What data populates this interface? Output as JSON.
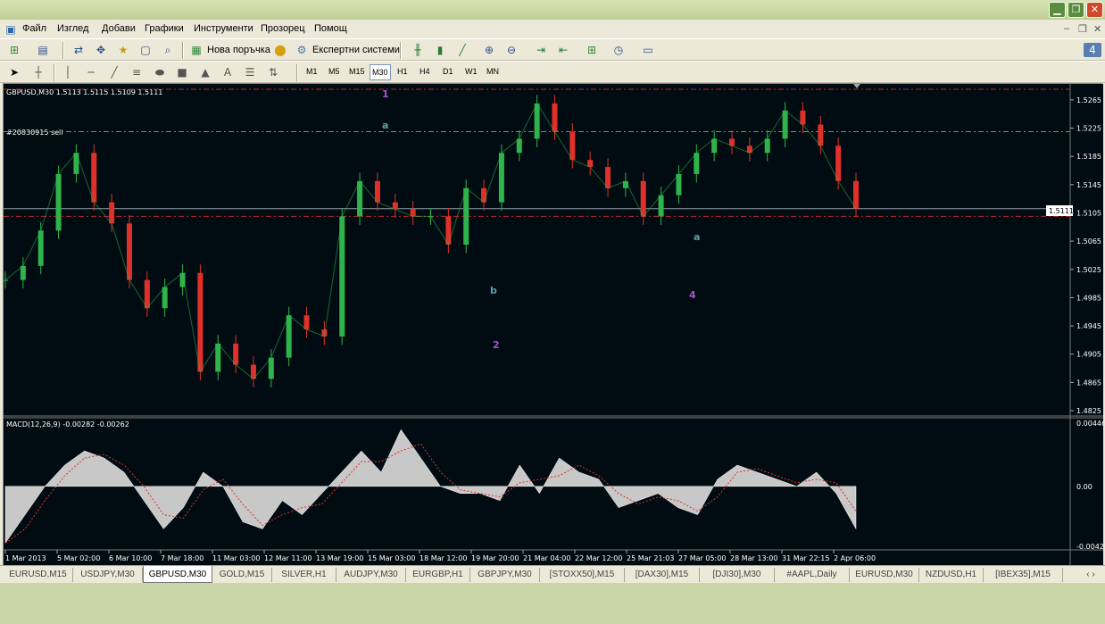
{
  "menu": [
    "Файл",
    "Изглед",
    "Добави",
    "Графики",
    "Инструменти",
    "Прозорец",
    "Помощ"
  ],
  "toolbar": {
    "new_order": "Нова поръчка",
    "expert_systems": "Експертни системи"
  },
  "timeframes": [
    "M1",
    "M5",
    "M15",
    "M30",
    "H1",
    "H4",
    "D1",
    "W1",
    "MN"
  ],
  "chart_info": "GBPUSD,M30  1.5113 1.5115 1.5109 1.5111",
  "order_label": "#20830915 sell",
  "current_price": "1.5111",
  "macd_label": "MACD(12,26,9) -0.00282 -0.00262",
  "wave_labels": [
    {
      "t": "1",
      "role": "purple"
    },
    {
      "t": "a",
      "role": "teal"
    },
    {
      "t": "b",
      "role": "teal"
    },
    {
      "t": "2",
      "role": "purple"
    },
    {
      "t": "4",
      "role": "purple"
    },
    {
      "t": "a",
      "role": "teal"
    }
  ],
  "tabs": [
    "EURUSD,M15",
    "USDJPY,M30",
    "GBPUSD,M30",
    "GOLD,M15",
    "SILVER,H1",
    "AUDJPY,M30",
    "EURGBP,H1",
    "GBPJPY,M30",
    "[STOXX50],M15",
    "[DAX30],M15",
    "[DJI30],M30",
    "#AAPL,Daily",
    "EURUSD,M30",
    "NZDUSD,H1",
    "[IBEX35],M15"
  ],
  "active_tab": "GBPUSD,M30",
  "colors": {
    "bull": "#2fb34a",
    "bear": "#e0302a",
    "grid_dash_red": "#c0242a",
    "grid_dash_green": "#7a9a2a",
    "macd_fill": "#c8c8c8",
    "wave_purple": "#b04fd0",
    "wave_teal": "#5f9fa8"
  },
  "chart_data": {
    "type": "line",
    "title": "GBPUSD,M30",
    "x_ticks": [
      "1 Mar 2013",
      "5 Mar 02:00",
      "6 Mar 10:00",
      "7 Mar 18:00",
      "11 Mar 03:00",
      "12 Mar 11:00",
      "13 Mar 19:00",
      "15 Mar 03:00",
      "18 Mar 12:00",
      "19 Mar 20:00",
      "21 Mar 04:00",
      "22 Mar 12:00",
      "25 Mar 21:03",
      "27 Mar 05:00",
      "28 Mar 13:00",
      "31 Mar 22:15",
      "2 Apr 06:00"
    ],
    "y_ticks": [
      "1.5265",
      "1.5225",
      "1.5185",
      "1.5145",
      "1.5105",
      "1.5065",
      "1.5025",
      "1.4985",
      "1.4945",
      "1.4905",
      "1.4865",
      "1.4825"
    ],
    "ylim": [
      1.4825,
      1.528
    ],
    "price": [
      1.501,
      1.503,
      1.508,
      1.516,
      1.519,
      1.512,
      1.509,
      1.501,
      1.497,
      1.5,
      1.502,
      1.488,
      1.492,
      1.489,
      1.487,
      1.49,
      1.496,
      1.494,
      1.493,
      1.51,
      1.515,
      1.512,
      1.511,
      1.51,
      1.51,
      1.506,
      1.514,
      1.512,
      1.519,
      1.521,
      1.526,
      1.522,
      1.518,
      1.517,
      1.514,
      1.515,
      1.51,
      1.513,
      1.516,
      1.519,
      1.521,
      1.52,
      1.519,
      1.521,
      1.525,
      1.523,
      1.52,
      1.515,
      1.5111
    ],
    "levels": [
      {
        "name": "red_dash_top",
        "value": 1.528
      },
      {
        "name": "green_dash",
        "value": 1.522
      },
      {
        "name": "current",
        "value": 1.5111
      },
      {
        "name": "red_dash_bottom",
        "value": 1.51
      }
    ],
    "macd": {
      "ylim": [
        -0.00423,
        0.00446
      ],
      "y_ticks": [
        "0.00446",
        "0.00",
        "-0.00423"
      ],
      "hist": [
        -0.004,
        -0.002,
        0.0,
        0.0015,
        0.0025,
        0.002,
        0.001,
        -0.001,
        -0.003,
        -0.0015,
        0.001,
        0.0,
        -0.0025,
        -0.003,
        -0.001,
        -0.002,
        -0.0005,
        0.001,
        0.0025,
        0.001,
        0.004,
        0.002,
        0.0,
        -0.0005,
        -0.0005,
        -0.001,
        0.0015,
        -0.0005,
        0.002,
        0.001,
        0.0005,
        -0.0015,
        -0.001,
        -0.0005,
        -0.0015,
        -0.002,
        0.0005,
        0.0015,
        0.001,
        0.0005,
        0.0,
        0.001,
        -0.0005,
        -0.003
      ]
    }
  }
}
